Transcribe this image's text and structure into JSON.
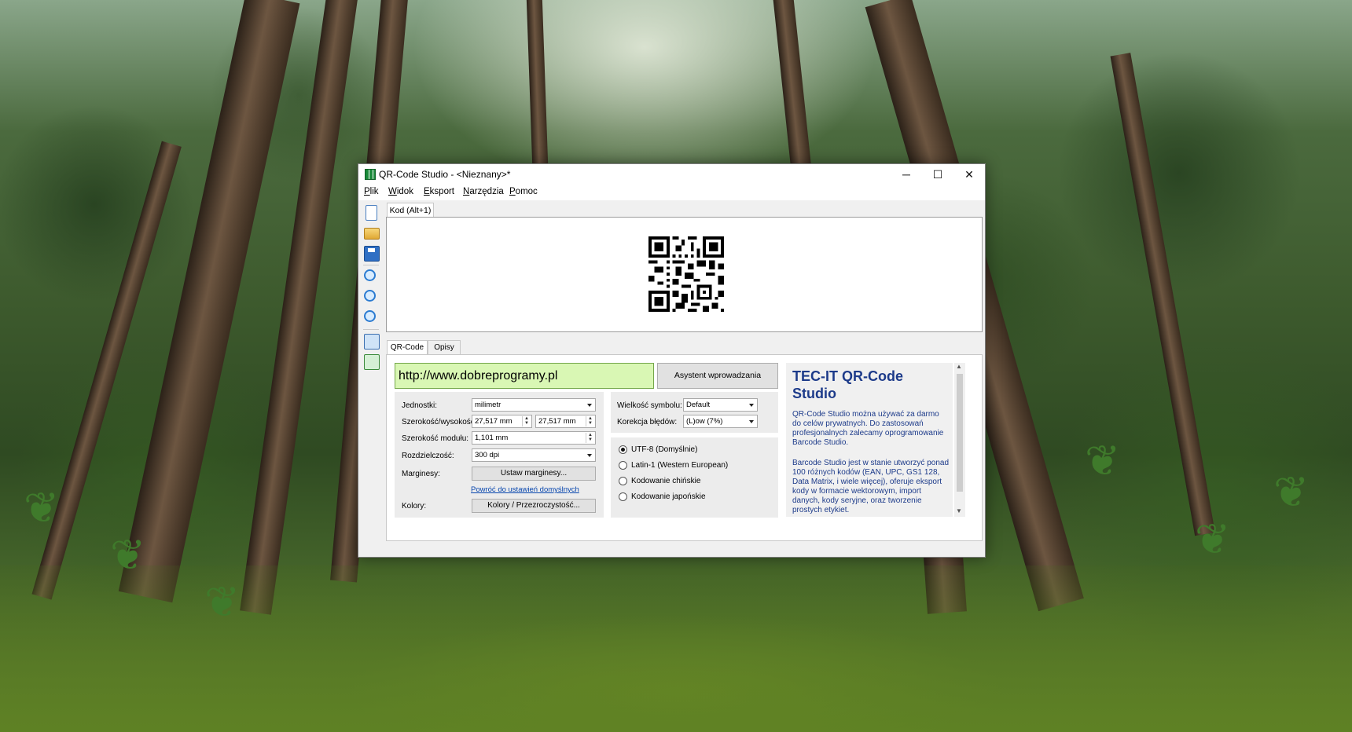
{
  "window": {
    "title": "QR-Code Studio - <Nieznany>*",
    "min_glyph": "─",
    "max_glyph": "☐",
    "close_glyph": "✕"
  },
  "menu": [
    "Plik",
    "Widok",
    "Eksport",
    "Narzędzia",
    "Pomoc"
  ],
  "toolbar": {
    "icons": [
      "new-document-icon",
      "open-folder-icon",
      "save-icon",
      "zoom-in-icon",
      "zoom-out-icon",
      "zoom-fit-icon",
      "copy-image-icon",
      "copy-special-icon"
    ]
  },
  "top_tab": "Kod (Alt+1)",
  "bottom_tabs": [
    "QR-Code",
    "Opisy"
  ],
  "data": {
    "value": "http://www.dobreprogramy.pl",
    "wizard_button": "Asystent wprowadzania danych..."
  },
  "settings": {
    "units_label": "Jednostki:",
    "units_value": "milimetr",
    "size_label": "Szerokość/wysokość:",
    "width_value": "27,517 mm",
    "height_value": "27,517 mm",
    "module_label": "Szerokość modułu:",
    "module_value": "1,101 mm",
    "resolution_label": "Rozdzielczość:",
    "resolution_value": "300 dpi",
    "margins_label": "Marginesy:",
    "margins_button": "Ustaw marginesy...",
    "reset_link": "Powróć do ustawień domyślnych",
    "colors_label": "Kolory:",
    "colors_button": "Kolory / Przezroczystość..."
  },
  "symbol": {
    "size_label": "Wielkość symbolu:",
    "size_value": "Default",
    "ecc_label": "Korekcja błędów:",
    "ecc_value": "(L)ow (7%)"
  },
  "encoding": {
    "options": [
      "UTF-8 (Domyślnie)",
      "Latin-1 (Western European)",
      "Kodowanie chińskie",
      "Kodowanie japońskie"
    ],
    "selected_index": 0
  },
  "info": {
    "title": "TEC-IT QR-Code Studio",
    "para1": "QR-Code Studio można używać za darmo do celów prywatnych. Do zastosowań profesjonalnych zalecamy oprogramowanie Barcode Studio.",
    "para2": "Barcode Studio jest w stanie utworzyć ponad 100 różnych kodów (EAN, UPC, GS1 128, Data Matrix, i wiele więcej), oferuje eksport kody w formacie wektorowym, import danych, kody seryjne, oraz tworzenie prostych etykiet."
  }
}
